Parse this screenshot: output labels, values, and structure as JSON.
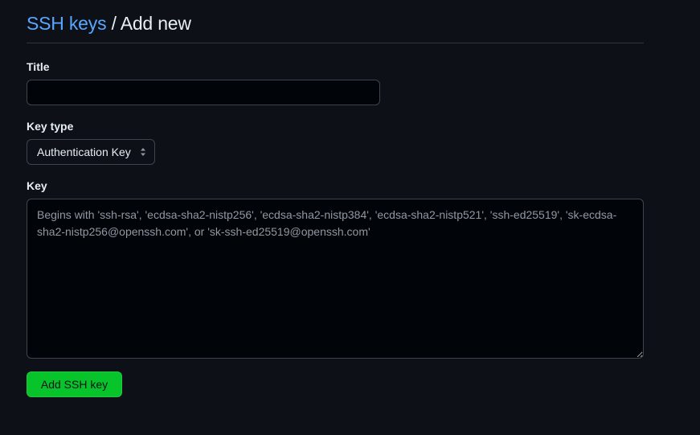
{
  "header": {
    "breadcrumb_link": "SSH keys",
    "separator": " / ",
    "page_title": "Add new"
  },
  "form": {
    "title_label": "Title",
    "title_value": "",
    "key_type_label": "Key type",
    "key_type_value": "Authentication Key",
    "key_label": "Key",
    "key_value": "",
    "key_placeholder": "Begins with 'ssh-rsa', 'ecdsa-sha2-nistp256', 'ecdsa-sha2-nistp384', 'ecdsa-sha2-nistp521', 'ssh-ed25519', 'sk-ecdsa-sha2-nistp256@openssh.com', or 'sk-ssh-ed25519@openssh.com'",
    "submit_label": "Add SSH key"
  },
  "colors": {
    "background": "#0d1117",
    "link": "#58a6ff",
    "primary_button": "#08c42b",
    "border": "#3d444d"
  },
  "icons": {
    "select_arrows": "select-arrows-icon"
  }
}
